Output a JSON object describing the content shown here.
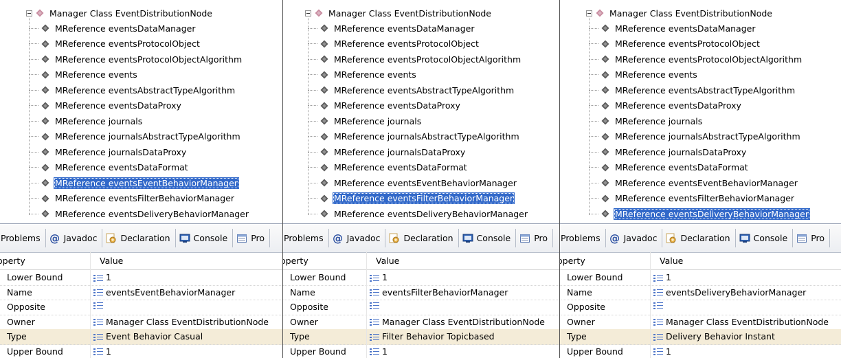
{
  "panels": [
    {
      "tree": {
        "root_label": "Manager Class EventDistributionNode",
        "items": [
          "MReference eventsDataManager",
          "MReference eventsProtocolObject",
          "MReference eventsProtocolObjectAlgorithm",
          "MReference events",
          "MReference eventsAbstractTypeAlgorithm",
          "MReference eventsDataProxy",
          "MReference journals",
          "MReference journalsAbstractTypeAlgorithm",
          "MReference journalsDataProxy",
          "MReference eventsDataFormat",
          "MReference eventsEventBehaviorManager",
          "MReference eventsFilterBehaviorManager",
          "MReference eventsDeliveryBehaviorManager"
        ],
        "selected_index": 10
      },
      "tabs": [
        "Problems",
        "Javadoc",
        "Declaration",
        "Console",
        "Pro"
      ],
      "properties": {
        "headers": [
          "operty",
          "Value"
        ],
        "rows": [
          {
            "key": "Lower Bound",
            "value": "1"
          },
          {
            "key": "Name",
            "value": "eventsEventBehaviorManager"
          },
          {
            "key": "Opposite",
            "value": ""
          },
          {
            "key": "Owner",
            "value": "Manager Class EventDistributionNode"
          },
          {
            "key": "Type",
            "value": "Event Behavior Casual"
          },
          {
            "key": "Upper Bound",
            "value": "1"
          }
        ],
        "selected_row": 4
      }
    },
    {
      "tree": {
        "root_label": "Manager Class EventDistributionNode",
        "items": [
          "MReference eventsDataManager",
          "MReference eventsProtocolObject",
          "MReference eventsProtocolObjectAlgorithm",
          "MReference events",
          "MReference eventsAbstractTypeAlgorithm",
          "MReference eventsDataProxy",
          "MReference journals",
          "MReference journalsAbstractTypeAlgorithm",
          "MReference journalsDataProxy",
          "MReference eventsDataFormat",
          "MReference eventsEventBehaviorManager",
          "MReference eventsFilterBehaviorManager",
          "MReference eventsDeliveryBehaviorManager"
        ],
        "selected_index": 11
      },
      "tabs": [
        "Problems",
        "Javadoc",
        "Declaration",
        "Console",
        "Pro"
      ],
      "properties": {
        "headers": [
          "operty",
          "Value"
        ],
        "rows": [
          {
            "key": "Lower Bound",
            "value": "1"
          },
          {
            "key": "Name",
            "value": "eventsFilterBehaviorManager"
          },
          {
            "key": "Opposite",
            "value": ""
          },
          {
            "key": "Owner",
            "value": "Manager Class EventDistributionNode"
          },
          {
            "key": "Type",
            "value": "Filter Behavior Topicbased"
          },
          {
            "key": "Upper Bound",
            "value": "1"
          }
        ],
        "selected_row": 4
      }
    },
    {
      "tree": {
        "root_label": "Manager Class EventDistributionNode",
        "items": [
          "MReference eventsDataManager",
          "MReference eventsProtocolObject",
          "MReference eventsProtocolObjectAlgorithm",
          "MReference events",
          "MReference eventsAbstractTypeAlgorithm",
          "MReference eventsDataProxy",
          "MReference journals",
          "MReference journalsAbstractTypeAlgorithm",
          "MReference journalsDataProxy",
          "MReference eventsDataFormat",
          "MReference eventsEventBehaviorManager",
          "MReference eventsFilterBehaviorManager",
          "MReference eventsDeliveryBehaviorManager"
        ],
        "selected_index": 12
      },
      "tabs": [
        "Problems",
        "Javadoc",
        "Declaration",
        "Console",
        "Pro"
      ],
      "properties": {
        "headers": [
          "operty",
          "Value"
        ],
        "rows": [
          {
            "key": "Lower Bound",
            "value": "1"
          },
          {
            "key": "Name",
            "value": "eventsDeliveryBehaviorManager"
          },
          {
            "key": "Opposite",
            "value": ""
          },
          {
            "key": "Owner",
            "value": "Manager Class EventDistributionNode"
          },
          {
            "key": "Type",
            "value": "Delivery Behavior Instant"
          },
          {
            "key": "Upper Bound",
            "value": "1"
          }
        ],
        "selected_row": 4
      }
    }
  ],
  "colors": {
    "selection": "#3168c9",
    "selected_row": "#f4ecd8",
    "diamond_root": "#c88ca0",
    "diamond_child": "#5a5a5a"
  },
  "icons": {
    "tabs": [
      "",
      "at-icon",
      "declaration-icon",
      "console-icon",
      "properties-icon"
    ],
    "value": "value-lines-icon"
  }
}
